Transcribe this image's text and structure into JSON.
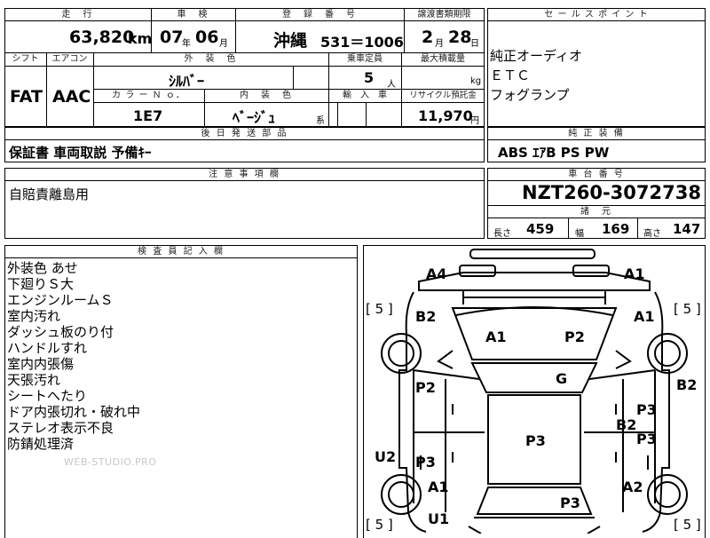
{
  "top_table": {
    "headers": {
      "mileage": "走　行",
      "inspection": "車　検",
      "registration": "登　録　番　号",
      "transfer_deadline": "譲渡書類期限",
      "selling_points": "セ ー ル ス ポ イ ン ト"
    },
    "mileage": {
      "value": "63,820",
      "unit": "km"
    },
    "inspection": {
      "year": "07",
      "year_unit": "年",
      "month": "06",
      "month_unit": "月"
    },
    "registration": {
      "region": "沖縄",
      "number": "531＝1006"
    },
    "transfer_deadline": {
      "month": "2",
      "month_unit": "月",
      "day": "28",
      "day_unit": "日"
    },
    "selling_points": [
      "純正オーディオ",
      "ＥＴＣ",
      "フォグランプ"
    ]
  },
  "spec_table": {
    "headers": {
      "shift": "シフト",
      "aircon": "エアコン",
      "exterior_color": "外　装　色",
      "capacity": "乗車定員",
      "max_load": "最大積載量",
      "color_no": "カ ラ ー Ｎ ｏ．",
      "interior_color": "内　装　色",
      "import": "輸　入　車",
      "recycle_deposit": "リサイクル預託金"
    },
    "shift": "FAT",
    "aircon": "AAC",
    "exterior_color": "ｼﾙﾊﾞｰ",
    "capacity": {
      "value": "5",
      "unit": "人"
    },
    "max_load": {
      "unit": "kg"
    },
    "color_no": "1E7",
    "interior_color": {
      "value": "ﾍﾞｰｼﾞｭ",
      "suffix": "系"
    },
    "recycle_deposit": {
      "value": "11,970",
      "unit": "円"
    }
  },
  "later_parts": {
    "header": "後 日 発 送 部 品",
    "value": "保証書 車両取説 予備ｷｰ"
  },
  "standard_equipment": {
    "header": "純 正 装 備",
    "value": "ABS ｴｱB PS PW"
  },
  "notes": {
    "header": "注 意 事 項 欄",
    "value": "自賠責離島用"
  },
  "chassis": {
    "header": "車 台 番 号",
    "value": "NZT260-3072738",
    "dims_header": "諸　元",
    "length_label": "長さ",
    "length": "459",
    "width_label": "幅",
    "width": "169",
    "height_label": "高さ",
    "height": "147"
  },
  "inspector_notes": {
    "header": "検 査 員 記 入 欄",
    "lines": [
      "外装色 あせ",
      "下廻りＳ大",
      "エンジンルームＳ",
      "室内汚れ",
      "ダッシュ板のり付",
      "ハンドルすれ",
      "室内内張傷",
      "天張汚れ",
      "シートへたり",
      "ドア内張切れ・破れ中",
      "ステレオ表示不良",
      "防錆処理済"
    ],
    "watermark": "WEB-STUDIO.PRO"
  },
  "diagram": {
    "labels": {
      "a4_top_left": "A4",
      "a1_top_right": "A1",
      "b2_left_front": "B2",
      "a1_right_front": "A1",
      "a1_hood_left": "A1",
      "p2_hood_right": "P2",
      "g_windshield": "G",
      "p2_left_door": "P2",
      "b2_right_side": "B2",
      "p3_right_door": "P3",
      "b2_right_mid": "B2",
      "p3_right_door2": "P3",
      "p3_roof": "P3",
      "u2_left": "U2",
      "p3_left_rear": "P3",
      "a1_left_rear": "A1",
      "a2_right_rear": "A2",
      "p3_trunk": "P3",
      "u1_bottom": "U1"
    },
    "bracket_left_top": "[ 5 ]",
    "bracket_right_top": "[ 5 ]",
    "bracket_left_bottom": "[ 5 ]",
    "bracket_right_bottom": "[ 5 ]"
  }
}
